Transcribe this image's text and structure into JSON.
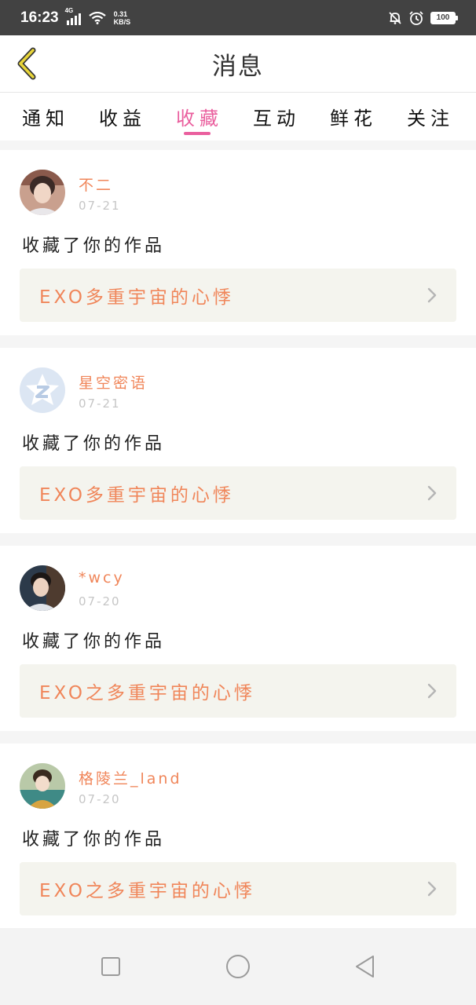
{
  "status_bar": {
    "time": "16:23",
    "network": "4G",
    "speed_value": "0.31",
    "speed_unit": "KB/S",
    "battery": "100"
  },
  "header": {
    "title": "消息"
  },
  "tabs": [
    {
      "label": "通知",
      "active": false
    },
    {
      "label": "收益",
      "active": false
    },
    {
      "label": "收藏",
      "active": true
    },
    {
      "label": "互动",
      "active": false
    },
    {
      "label": "鲜花",
      "active": false
    },
    {
      "label": "关注",
      "active": false
    }
  ],
  "messages": [
    {
      "user": "不二",
      "date": "07-21",
      "action": "收藏了你的作品",
      "work_title": "EXO多重宇宙的心悸"
    },
    {
      "user": "星空密语",
      "date": "07-21",
      "action": "收藏了你的作品",
      "work_title": "EXO多重宇宙的心悸"
    },
    {
      "user": "*wcy",
      "date": "07-20",
      "action": "收藏了你的作品",
      "work_title": "EXO之多重宇宙的心悸"
    },
    {
      "user": "格陵兰_land",
      "date": "07-20",
      "action": "收藏了你的作品",
      "work_title": "EXO之多重宇宙的心悸"
    }
  ],
  "colors": {
    "accent_pink": "#ea5f9e",
    "accent_orange": "#f0865a",
    "back_arrow": "#e8d53a"
  },
  "icons": {
    "back": "back-arrow-icon",
    "chevron": "chevron-right-icon",
    "nav": [
      "recent-apps-icon",
      "home-icon",
      "back-triangle-icon"
    ]
  }
}
